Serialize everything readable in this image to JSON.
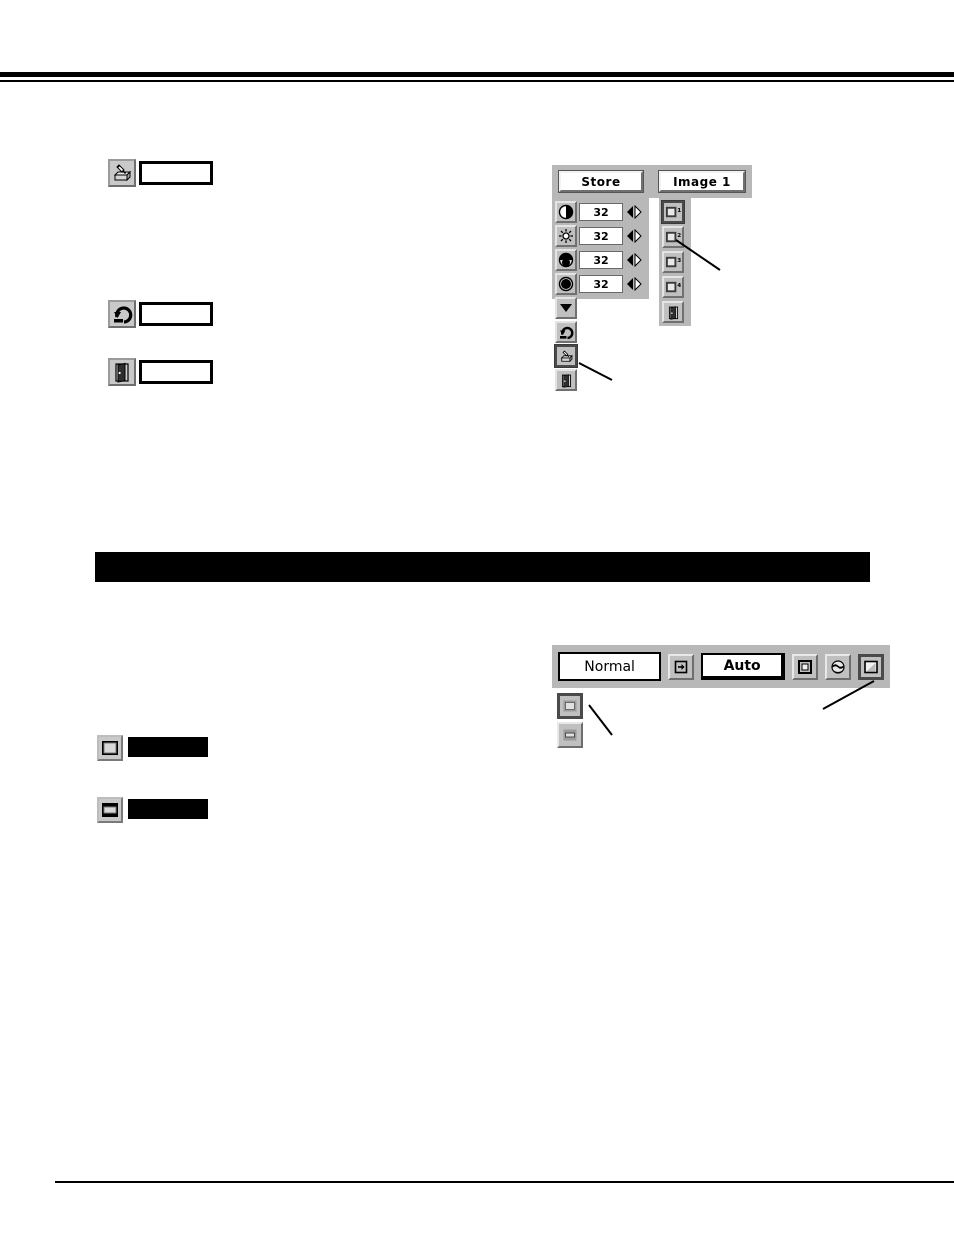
{
  "page": {
    "background": "#ffffff",
    "rules": {
      "top_thick": true,
      "top_thin": true,
      "bottom": true
    }
  },
  "section_header": {
    "name": "redacted-section-header",
    "text": "",
    "color": "#000000"
  },
  "left_legend": {
    "items": [
      {
        "icon": "store-hand-icon",
        "label": "",
        "note": "empty white callout box"
      },
      {
        "icon": "reset-arrow-icon",
        "label": "",
        "note": "empty white callout box"
      },
      {
        "icon": "quit-door-icon",
        "label": "",
        "note": "empty white callout box"
      }
    ],
    "screen_items": [
      {
        "icon": "screen-normal-icon",
        "label": "",
        "redacted": true
      },
      {
        "icon": "screen-wide-icon",
        "label": "",
        "redacted": true
      }
    ]
  },
  "image_adjust_dialog": {
    "name": "image-adjust-dialog",
    "header": {
      "store_label": "Store",
      "image_label": "Image 1"
    },
    "adjustments": [
      {
        "icon": "contrast-icon",
        "value": "32",
        "arrows": "left-right-arrows"
      },
      {
        "icon": "brightness-icon",
        "value": "32",
        "arrows": "left-right-arrows"
      },
      {
        "icon": "color-icon",
        "value": "32",
        "arrows": "left-right-arrows"
      },
      {
        "icon": "tint-icon",
        "value": "32",
        "arrows": "left-right-arrows"
      }
    ],
    "tools": [
      {
        "icon": "scroll-down-icon",
        "selected": false
      },
      {
        "icon": "reset-arrow-icon",
        "selected": false
      },
      {
        "icon": "store-hand-icon",
        "selected": true
      },
      {
        "icon": "quit-door-icon",
        "selected": false
      }
    ],
    "image_slots": [
      {
        "icon": "image-slot-icon",
        "number": "1",
        "selected": true
      },
      {
        "icon": "image-slot-icon",
        "number": "2",
        "selected": false
      },
      {
        "icon": "image-slot-icon",
        "number": "3",
        "selected": false
      },
      {
        "icon": "image-slot-icon",
        "number": "4",
        "selected": false
      },
      {
        "icon": "quit-door-icon",
        "number": "",
        "selected": false
      }
    ],
    "colors": {
      "panel": "#b8b8b8",
      "button_face": "#c0c0c0",
      "field": "#ffffff"
    }
  },
  "screen_dialog": {
    "name": "screen-size-dialog",
    "normal_label": "Normal",
    "auto_label": "Auto",
    "expand_icon": "expand-arrow-icon",
    "mode_icons": [
      {
        "icon": "screen-true-icon",
        "selected": false
      },
      {
        "icon": "screen-digital-icon",
        "selected": false
      },
      {
        "icon": "screen-custom-icon",
        "selected": true
      }
    ],
    "sub_icons": [
      {
        "icon": "screen-normal-icon",
        "selected": true
      },
      {
        "icon": "screen-wide-icon",
        "selected": false
      }
    ],
    "colors": {
      "panel": "#b8b8b8",
      "button_face": "#c0c0c0"
    }
  }
}
